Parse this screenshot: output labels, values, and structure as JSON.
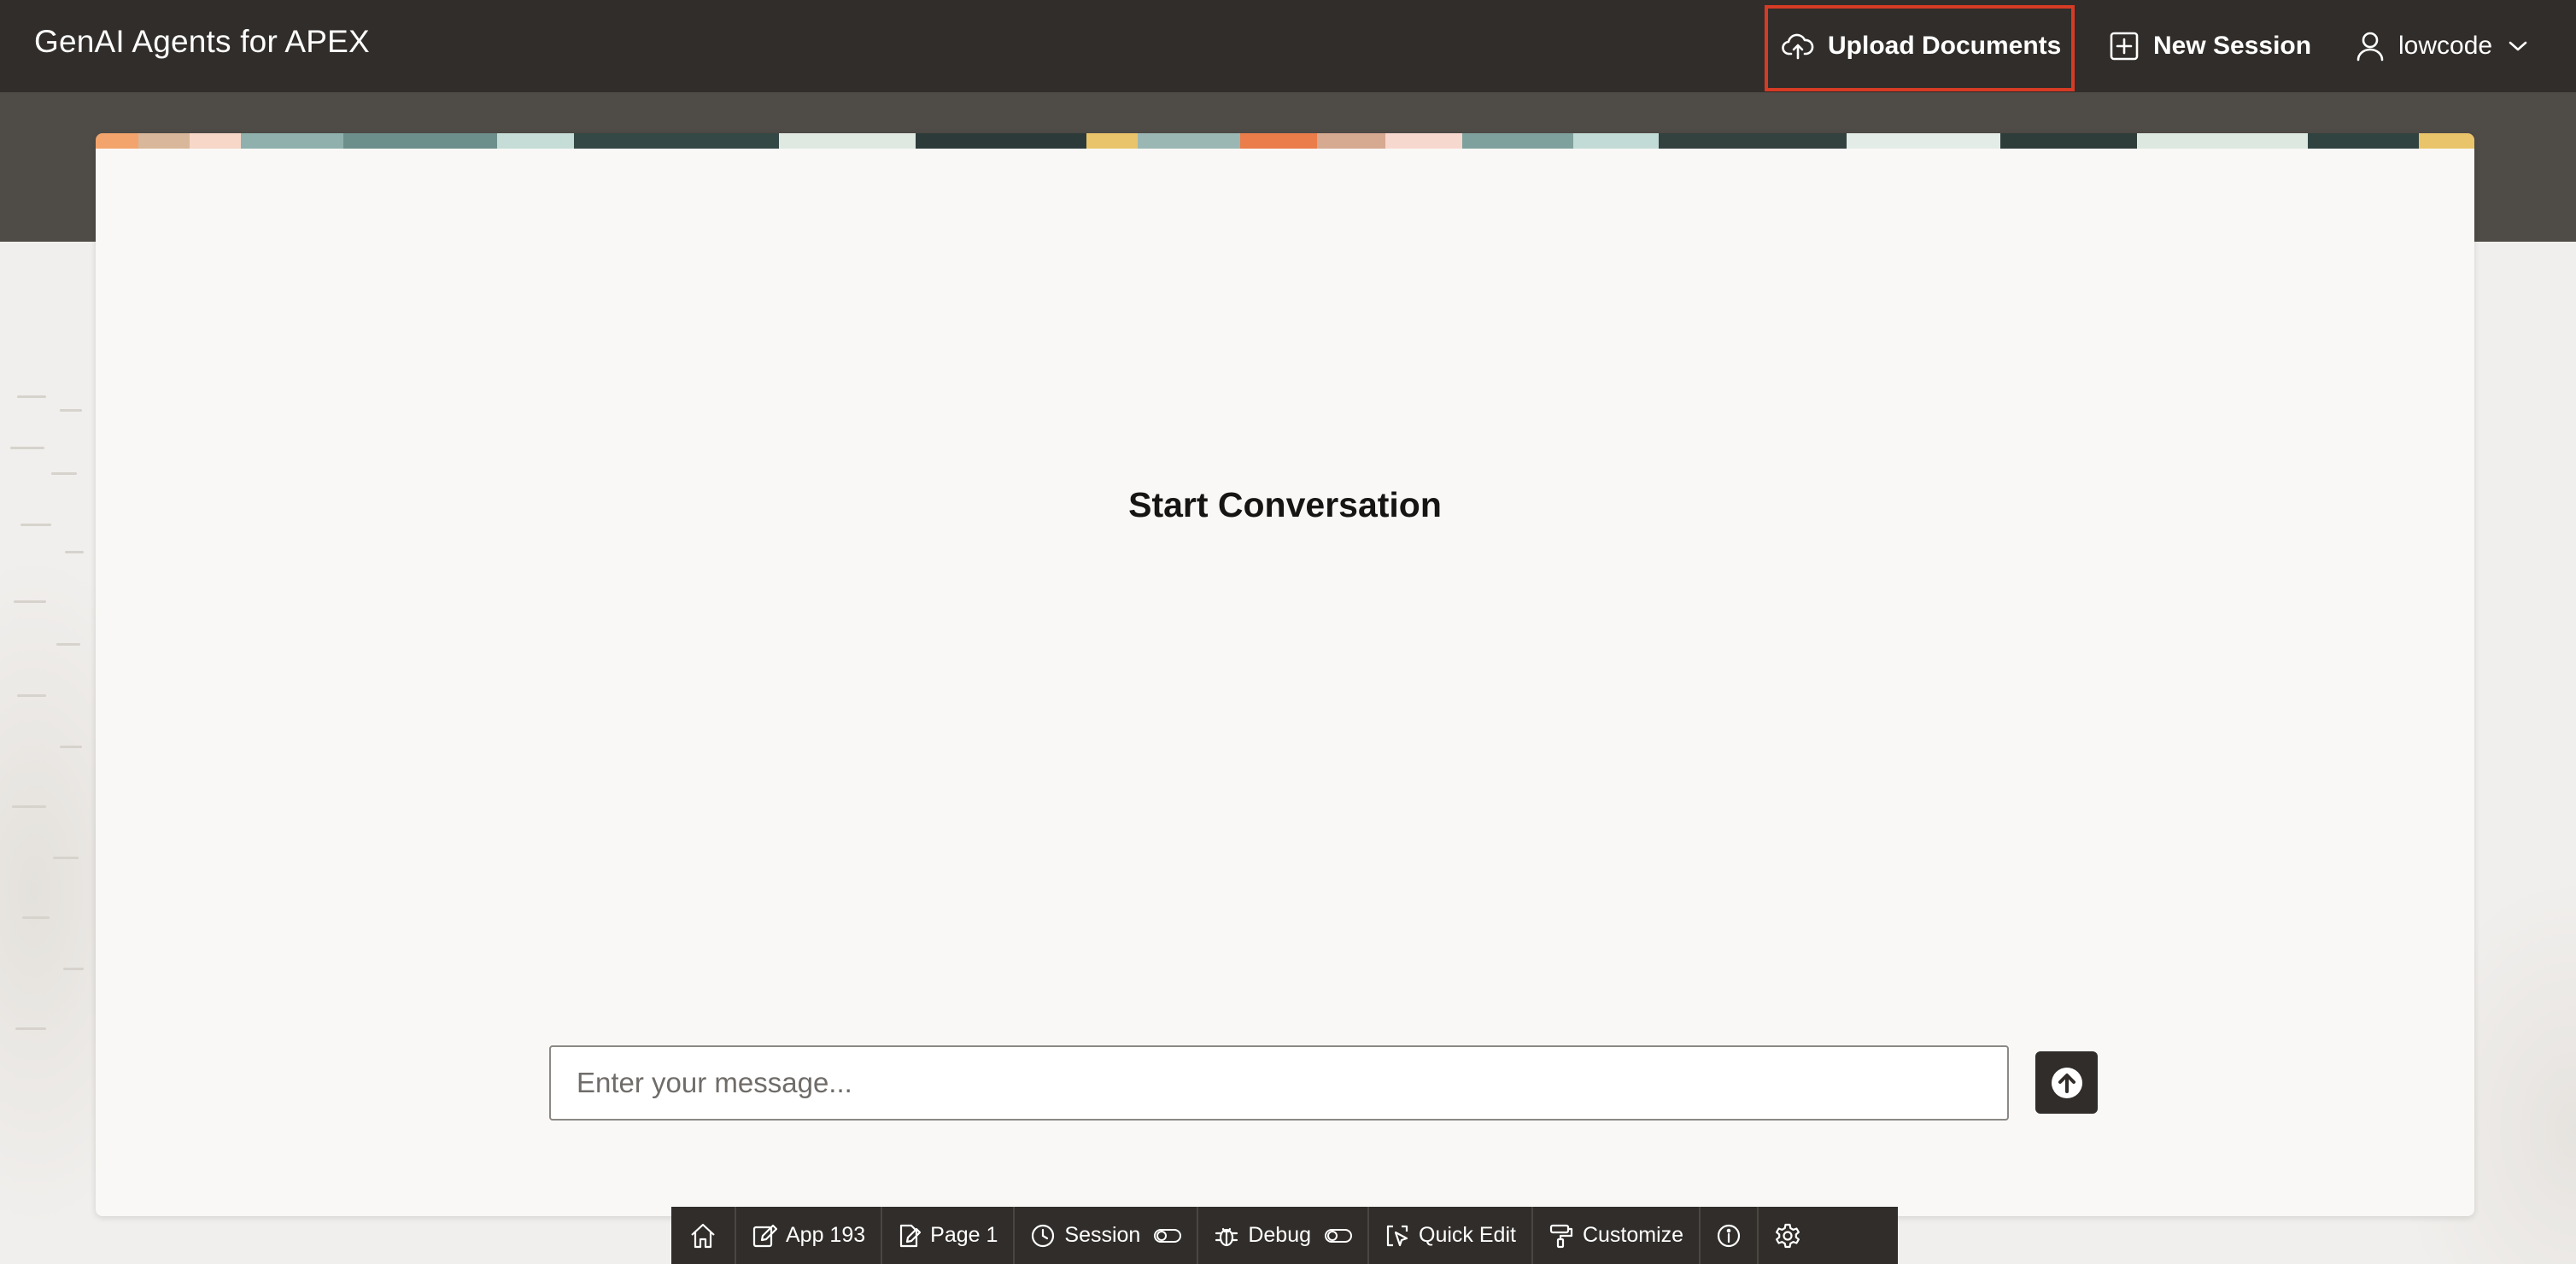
{
  "header": {
    "app_title": "GenAI Agents for APEX",
    "upload_label": "Upload Documents",
    "new_session_label": "New Session",
    "user_label": "lowcode"
  },
  "main": {
    "title": "Start Conversation",
    "input_placeholder": "Enter your message..."
  },
  "dev_toolbar": {
    "app_label": "App 193",
    "page_label": "Page 1",
    "session_label": "Session",
    "debug_label": "Debug",
    "quick_edit_label": "Quick Edit",
    "customize_label": "Customize"
  },
  "colors": {
    "header_bg": "#312d2a",
    "band_bg": "#4f4b47",
    "highlight": "#d63b25",
    "card_bg": "#f9f8f6",
    "page_bg": "#f1efed"
  },
  "icons": [
    "cloud-upload-icon",
    "plus-square-icon",
    "user-icon",
    "chevron-down-icon",
    "arrow-up-circle-icon",
    "home-icon",
    "edit-icon",
    "page-edit-icon",
    "session-icon",
    "toggle-icon",
    "bug-icon",
    "quick-edit-icon",
    "paint-roller-icon",
    "info-icon",
    "gear-icon"
  ]
}
